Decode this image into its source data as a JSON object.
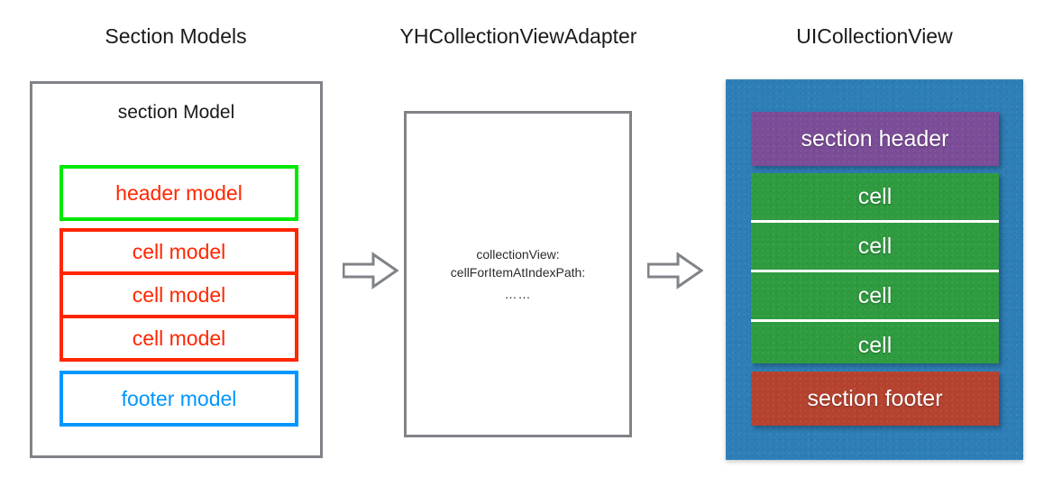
{
  "columns": {
    "left_title": "Section Models",
    "middle_title": "YHCollectionViewAdapter",
    "right_title": "UICollectionView"
  },
  "left_panel": {
    "label": "section Model",
    "header_model": "header model",
    "cell_models": [
      "cell model",
      "cell model",
      "cell model"
    ],
    "footer_model": "footer model",
    "colors": {
      "panel_border": "#808388",
      "header_model_border": "#00E800",
      "cell_model_border": "#FF2600",
      "cell_model_text": "#FF2600",
      "footer_model_border": "#0096FF",
      "footer_model_text": "#0096FF"
    }
  },
  "middle_panel": {
    "lines": [
      "collectionView:",
      "cellForItemAtIndexPath:",
      "……"
    ],
    "colors": {
      "border": "#808388"
    }
  },
  "right_panel": {
    "section_header": "section header",
    "cells": [
      "cell",
      "cell",
      "cell",
      "cell"
    ],
    "section_footer": "section footer",
    "colors": {
      "background": "#2E7FB8",
      "header": "#7B4C97",
      "cell": "#2E9B3F",
      "footer": "#B5422F",
      "separator": "#FFFFFF",
      "text": "#FFFFFF"
    }
  },
  "arrows": {
    "first": "arrow-right",
    "second": "arrow-right",
    "color": "#808388"
  }
}
